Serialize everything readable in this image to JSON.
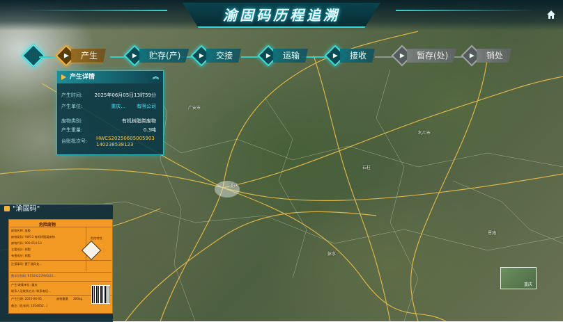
{
  "header": {
    "title": "渝固码历程追溯"
  },
  "steps": [
    {
      "label": "产生",
      "state": "active"
    },
    {
      "label": "贮存(产)",
      "state": "done"
    },
    {
      "label": "交接",
      "state": "done"
    },
    {
      "label": "运输",
      "state": "done"
    },
    {
      "label": "接收",
      "state": "done"
    },
    {
      "label": "暂存(处)",
      "state": "pending"
    },
    {
      "label": "销处",
      "state": "pending"
    }
  ],
  "detail": {
    "title": "产生详情",
    "fields": [
      {
        "label": "产生时间:",
        "value": "2025年06月05日13时59分"
      },
      {
        "label": "产生单位:",
        "value": "重庆..."
      },
      {
        "label": "废物类别:",
        "value": "有机树脂类废物"
      },
      {
        "label": "产生重量:",
        "value": "0.3吨"
      },
      {
        "label": "台账批次号:",
        "value": "HWCS20250605005903140238538123"
      }
    ],
    "unit_suffix": "有限公司"
  },
  "code_panel": {
    "title": "\"渝固码\"",
    "label": {
      "heading": "危险废物",
      "rows": [
        "废物名称: 废胶",
        "废物类别: HW13 有机树脂类废物",
        "废物代码: 900-014-13",
        "主要成分: 树脂",
        "有害成分: 树脂",
        "注意事项: 置于通风处...",
        "数字识别码: 91500227MA5U3...",
        "产生/收集单位: 重庆",
        "联系人及联系方式: 联系电话...",
        "产生日期: 2025-06-05",
        "备注: (危化码: 1054652...)"
      ],
      "weight_label": "废物重量",
      "weight_value": "300kg",
      "hazard_label": "危险特性"
    }
  },
  "map": {
    "thumbnail_label": "重庆"
  },
  "icons": {
    "home": "home-icon"
  },
  "colors": {
    "accent": "#2fd0c8",
    "active": "#f2b43a",
    "label_bg": "#f29a24"
  }
}
